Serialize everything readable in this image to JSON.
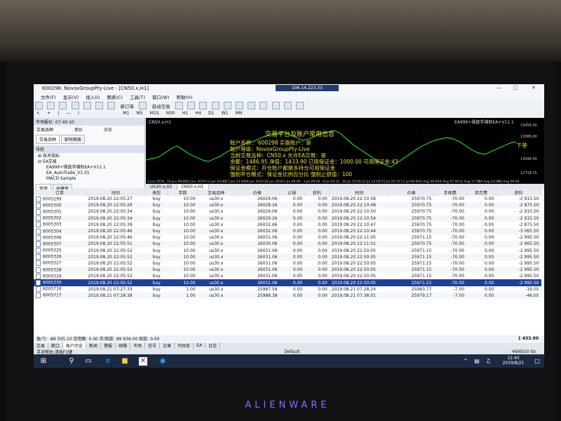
{
  "window": {
    "title": "600298: NovoxGroupPty-Live - [CN50.x,H1]",
    "server": "106.14.223.33"
  },
  "menu": [
    "文件(F)",
    "显示(V)",
    "插入(I)",
    "图表(C)",
    "工具(T)",
    "窗口(W)",
    "帮助(H)"
  ],
  "toolbar": {
    "new_order": "新订单",
    "auto_trade": "自动交易"
  },
  "timeframes": [
    "M1",
    "M5",
    "M15",
    "M30",
    "H1",
    "H4",
    "D1",
    "W1",
    "MN"
  ],
  "market_watch": {
    "header": "市场报价: 07:40:10",
    "col_symbol": "交易品种",
    "col_bid": "卖价",
    "col_ask": "买价",
    "tab_symbols": "交易品种",
    "tab_ticks": "即时图表"
  },
  "navigator": {
    "header": "导航",
    "tree": [
      "技术指标",
      "EA交易",
      "EA999+操盘手辅助EA+V11.1",
      "EA_AutoTrade_V1.01",
      "MACD Sample"
    ],
    "tab_common": "常用",
    "tab_favorites": "收藏夹"
  },
  "chart": {
    "label": "CN50.x,H1",
    "ea_label": "EA999+操盘手辅助EA+V11.1",
    "right_label": "下单",
    "prices": [
      "13456.00",
      "13088.00",
      "13096.40",
      "12718.15"
    ],
    "dates": [
      "3 Jun 2019",
      "10 Jun 09:00",
      "12 Jun 2019",
      "13 Jun 19:00",
      "17 Jun 23:00",
      "19 Jun 2019",
      "26 Jun 2019",
      "1 Jul 09:00",
      "3 Jul 09:00",
      "8 Jul 19:15",
      "10 Jul 15:00",
      "12 Jul 23:00",
      "15 Jul 19:15",
      "17 Jul 09:00",
      "6 Aug 09:00",
      "8 Aug 07:00",
      "12 Aug 17:00",
      "14 Aug 23:00",
      "16 Aug 09:00"
    ]
  },
  "overlay": {
    "title": "交易平台及账户常用信息",
    "line1": "账户名称：  600298  实盘账户：是",
    "line2": "账户等级：NovoxGroupPty-Live",
    "line3": "当前交易品种：CN50.x  允许EA交易：是",
    "line4": "余额：1486.95  净值：1433.90  已用保证金：1000.00  可用保证金:43",
    "line5": "保证金模式：开仓账户都做多持仓可用保证金",
    "line6": "强制平仓模式：保证金比例百分比  强制止损值：100"
  },
  "chart_tabs": [
    "US30.x,H1",
    "CN50.x,H1"
  ],
  "orders": {
    "headers": [
      "订单",
      "时间",
      "类型",
      "手数",
      "交易品种",
      "价格",
      "止损",
      "获利",
      "时间",
      "价格",
      "手续费",
      "库存费",
      "获利"
    ],
    "rows": [
      [
        "6005299",
        "2019.08.20 22:05:27",
        "buy",
        "10.00",
        "us30.x",
        "26029.06",
        "0.00",
        "0.00",
        "2019.08.20 22:10:58",
        "25970.75",
        "-70.00",
        "0.00",
        "-2 915.50"
      ],
      [
        "6005300",
        "2019.08.20 22:05:29",
        "buy",
        "10.00",
        "us30.x",
        "26028.26",
        "0.00",
        "0.00",
        "2019.08.20 22:10:48",
        "25970.75",
        "-70.00",
        "0.00",
        "-2 875.50"
      ],
      [
        "6005301",
        "2019.08.20 22:05:34",
        "buy",
        "10.00",
        "us30.x",
        "26029.06",
        "0.00",
        "0.00",
        "2019.08.20 22:10:50",
        "25970.75",
        "-70.00",
        "0.00",
        "-2 915.50"
      ],
      [
        "6005302",
        "2019.08.20 22:05:34",
        "buy",
        "10.00",
        "us30.x",
        "26029.26",
        "0.00",
        "0.00",
        "2019.08.20 22:10:54",
        "25970.75",
        "-70.00",
        "0.00",
        "-2 915.50"
      ],
      [
        "6005303",
        "2019.08.20 22:05:39",
        "buy",
        "10.00",
        "us30.x",
        "26032.66",
        "0.00",
        "0.00",
        "2019.08.20 22:10:47",
        "25970.75",
        "-70.00",
        "0.00",
        "-2 875.50"
      ],
      [
        "6005304",
        "2019.08.20 22:05:46",
        "buy",
        "10.00",
        "us30.x",
        "26032.06",
        "0.00",
        "0.00",
        "2019.08.20 22:10:44",
        "25970.75",
        "-70.00",
        "0.00",
        "-3 065.50"
      ],
      [
        "6005306",
        "2019.08.20 22:05:46",
        "buy",
        "10.00",
        "us30.x",
        "26031.06",
        "0.00",
        "0.00",
        "2019.08.20 22:11:05",
        "25971.15",
        "-70.00",
        "0.00",
        "-2 995.50"
      ],
      [
        "6005307",
        "2019.08.20 22:05:51",
        "buy",
        "10.00",
        "us30.x",
        "26030.06",
        "0.00",
        "0.00",
        "2019.08.20 22:11:01",
        "25970.75",
        "-70.00",
        "0.00",
        "-2 965.50"
      ],
      [
        "6005325",
        "2019.08.20 22:05:52",
        "buy",
        "10.00",
        "us30.x",
        "26031.06",
        "0.00",
        "0.00",
        "2019.08.20 22:50:05",
        "25971.15",
        "-70.00",
        "0.00",
        "-2 995.50"
      ],
      [
        "6005326",
        "2019.08.20 22:05:52",
        "buy",
        "10.00",
        "us30.x",
        "26031.06",
        "0.00",
        "0.00",
        "2019.08.20 22:50:05",
        "25971.15",
        "-70.00",
        "0.00",
        "-2 995.50"
      ],
      [
        "6005327",
        "2019.08.20 22:05:52",
        "buy",
        "10.00",
        "us30.x",
        "26031.06",
        "0.00",
        "0.00",
        "2019.08.20 22:50:05",
        "25971.15",
        "-70.00",
        "0.00",
        "-2 995.50"
      ],
      [
        "6005328",
        "2019.08.20 22:05:52",
        "buy",
        "10.00",
        "us30.x",
        "26031.06",
        "0.00",
        "0.00",
        "2019.08.20 22:50:05",
        "25971.15",
        "-70.00",
        "0.00",
        "-2 995.50"
      ],
      [
        "6005329",
        "2019.08.20 22:05:52",
        "buy",
        "10.00",
        "us30.x",
        "26031.06",
        "0.00",
        "0.00",
        "2019.08.20 22:50:05",
        "25971.15",
        "-70.00",
        "0.00",
        "-2 995.50"
      ],
      [
        "6005330",
        "2019.08.20 22:05:52",
        "buy",
        "10.00",
        "us30.x",
        "26031.06",
        "0.00",
        "0.00",
        "2019.08.20 22:50:05",
        "25971.15",
        "-70.00",
        "0.00",
        "-2 995.50"
      ],
      [
        "6005716",
        "2019.08.21 07:27:33",
        "buy",
        "1.00",
        "us30.x",
        "25987.58",
        "0.00",
        "0.00",
        "2019.08.21 07:28:24",
        "25983.77",
        "-7.00",
        "0.00",
        "-19.05"
      ],
      [
        "6005717",
        "2019.08.21 07:28:38",
        "buy",
        "1.00",
        "us30.x",
        "25988.38",
        "0.00",
        "0.00",
        "2019.08.21 07:38:01",
        "25979.17",
        "-7.00",
        "0.00",
        "-46.05"
      ]
    ],
    "selected_index": 13
  },
  "balance": {
    "text": "盈/亏: -88 505.10  信用额: 0.00  存/取款: 89 939.00  取款: 0.00",
    "total": "1 433.90"
  },
  "bottom_tabs": [
    "交易",
    "敞口",
    "账户历史",
    "新闻",
    "警报",
    "邮箱",
    "市场",
    "信号",
    "文章",
    "代码库",
    "EA",
    "日志"
  ],
  "status": {
    "help": "寻求帮助,请按F1键",
    "profile": "Default",
    "net": "4699/20 kb"
  },
  "taskbar": {
    "time": "12:40",
    "date": "2019/8/21"
  },
  "device": {
    "brand": "ALIENWARE"
  },
  "colors": {
    "selected_row": "#1f3f9b",
    "chart_bg": "#000000",
    "candle_up": "#22cc22",
    "overlay_text": "#e8e13a"
  }
}
